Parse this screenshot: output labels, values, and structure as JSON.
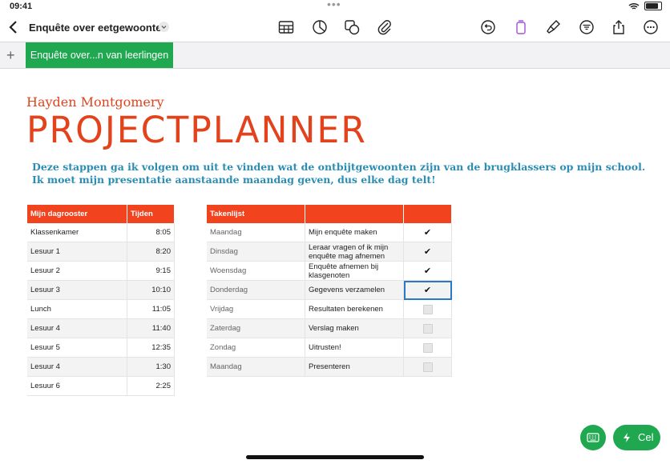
{
  "status": {
    "time": "09:41"
  },
  "toolbar": {
    "document_title": "Enquête over eetgewoonten",
    "icons": [
      "table-icon",
      "chart-icon",
      "shape-icon",
      "attachment-icon",
      "undo-icon",
      "format-icon",
      "brush-icon",
      "filter-icon",
      "share-icon",
      "more-icon"
    ]
  },
  "sheet": {
    "tab_label": "Enquête over...n van leerlingen"
  },
  "content": {
    "author": "Hayden Montgomery",
    "title": "PROJECTPLANNER",
    "description_line1": "Deze stappen ga ik volgen om uit te vinden wat de ontbijtgewoonten zijn van de brugklassers op mijn school.",
    "description_line2": "Ik moet mijn presentatie aanstaande maandag geven, dus elke dag telt!"
  },
  "schedule": {
    "headers": [
      "Mijn dagrooster",
      "Tijden"
    ],
    "rows": [
      [
        "Klassenkamer",
        "8:05"
      ],
      [
        "Lesuur 1",
        "8:20"
      ],
      [
        "Lesuur 2",
        "9:15"
      ],
      [
        "Lesuur 3",
        "10:10"
      ],
      [
        "Lunch",
        "11:05"
      ],
      [
        "Lesuur 4",
        "11:40"
      ],
      [
        "Lesuur 5",
        "12:35"
      ],
      [
        "Lesuur 4",
        "1:30"
      ],
      [
        "Lesuur 6",
        "2:25"
      ]
    ]
  },
  "tasks": {
    "headers": [
      "Takenlijst",
      "",
      ""
    ],
    "rows": [
      {
        "day": "Maandag",
        "task": "Mijn enquête maken",
        "done": true
      },
      {
        "day": "Dinsdag",
        "task": "Leraar vragen of ik mijn enquête mag afnemen",
        "done": true
      },
      {
        "day": "Woensdag",
        "task": "Enquête afnemen bij klasgenoten",
        "done": true
      },
      {
        "day": "Donderdag",
        "task": "Gegevens verzamelen",
        "done": true
      },
      {
        "day": "Vrijdag",
        "task": "Resultaten berekenen",
        "done": false
      },
      {
        "day": "Zaterdag",
        "task": "Verslag maken",
        "done": false
      },
      {
        "day": "Zondag",
        "task": "Uitrusten!",
        "done": false
      },
      {
        "day": "Maandag",
        "task": "Presenteren",
        "done": false
      }
    ]
  },
  "fab": {
    "cell_label": "Cel"
  },
  "colors": {
    "accent_red": "#e2431d",
    "header_red": "#f0431e",
    "green": "#1fa84f",
    "blue_text": "#2a8db3",
    "selection": "#2b78c5"
  }
}
